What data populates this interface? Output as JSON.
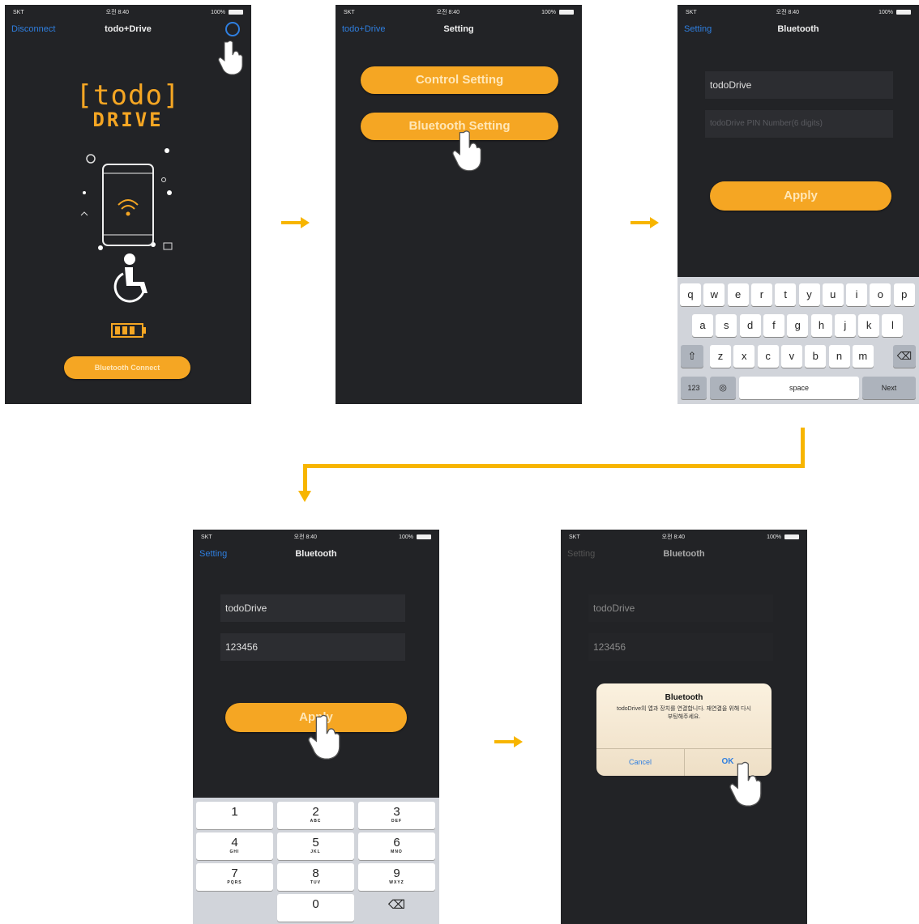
{
  "screen1": {
    "status": {
      "carrier": "SKT",
      "time": "오전 8:40",
      "battery": "100%"
    },
    "nav": {
      "back": "Disconnect",
      "title": "todo+Drive"
    },
    "logo": {
      "line1": "[todo]",
      "line2": "DRIVE"
    },
    "button": "Bluetooth Connect"
  },
  "screen2": {
    "status": {
      "carrier": "SKT",
      "time": "오전 8:40",
      "battery": "100%"
    },
    "nav": {
      "back": "todo+Drive",
      "title": "Setting"
    },
    "buttons": [
      "Control Setting",
      "Bluetooth Setting"
    ]
  },
  "screen3": {
    "status": {
      "carrier": "SKT",
      "time": "오전 8:40",
      "battery": "100%"
    },
    "nav": {
      "back": "Setting",
      "title": "Bluetooth"
    },
    "name_value": "todoDrive",
    "pin_placeholder": "todoDrive PIN Number(6 digits)",
    "apply": "Apply",
    "keyboard": {
      "row1": [
        "q",
        "w",
        "e",
        "r",
        "t",
        "y",
        "u",
        "i",
        "o",
        "p"
      ],
      "row2": [
        "a",
        "s",
        "d",
        "f",
        "g",
        "h",
        "j",
        "k",
        "l"
      ],
      "row3": [
        "z",
        "x",
        "c",
        "v",
        "b",
        "n",
        "m"
      ],
      "numbers": "123",
      "space": "space",
      "next": "Next"
    }
  },
  "screen4": {
    "status": {
      "carrier": "SKT",
      "time": "오전 8:40",
      "battery": "100%"
    },
    "nav": {
      "back": "Setting",
      "title": "Bluetooth"
    },
    "name_value": "todoDrive",
    "pin_value": "123456",
    "apply": "Apply",
    "keypad": [
      {
        "d": "1",
        "l": ""
      },
      {
        "d": "2",
        "l": "ABC"
      },
      {
        "d": "3",
        "l": "DEF"
      },
      {
        "d": "4",
        "l": "GHI"
      },
      {
        "d": "5",
        "l": "JKL"
      },
      {
        "d": "6",
        "l": "MNO"
      },
      {
        "d": "7",
        "l": "PQRS"
      },
      {
        "d": "8",
        "l": "TUV"
      },
      {
        "d": "9",
        "l": "WXYZ"
      },
      {
        "d": "",
        "l": ""
      },
      {
        "d": "0",
        "l": ""
      },
      {
        "d": "⌫",
        "l": ""
      }
    ]
  },
  "screen5": {
    "status": {
      "carrier": "SKT",
      "time": "오전 8:40",
      "battery": "100%"
    },
    "nav": {
      "back": "Setting",
      "title": "Bluetooth"
    },
    "name_value": "todoDrive",
    "pin_value": "123456",
    "dialog": {
      "title": "Bluetooth",
      "message": "todoDrive의 앱과 장치를 연결합니다. 재연결을 위해 다시 부팅해주세요.",
      "cancel": "Cancel",
      "ok": "OK"
    }
  },
  "colors": {
    "accent": "#f5a623",
    "flow_arrow": "#f7b500",
    "link": "#2f7fe0",
    "screen_bg": "#222326"
  }
}
